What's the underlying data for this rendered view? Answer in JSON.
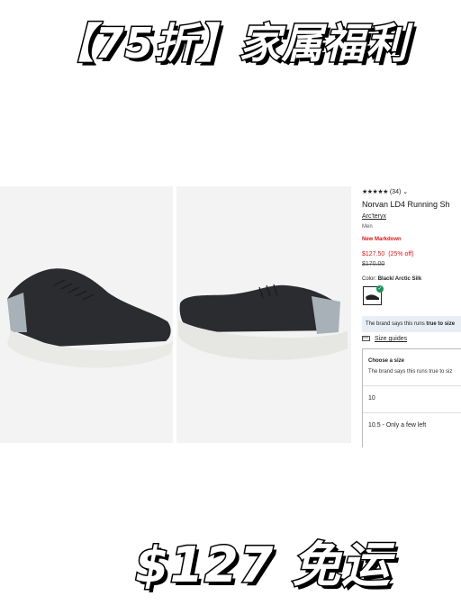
{
  "promo": {
    "top_text": "【75折】家属福利",
    "bottom_text": "$127 免运"
  },
  "product": {
    "stars": "★★★★★",
    "review_count": "(34)",
    "chevron": "⌄",
    "title": "Norvan LD4 Running Sh",
    "brand": "Arc'teryx",
    "category": "Men",
    "badge": "New Markdown",
    "sale_price": "$127.50",
    "discount": "(25% off)",
    "original_price": "$170.00",
    "color_label": "Color:",
    "color_value": "Black/ Arctic Silk",
    "fit_prefix": "The brand says this runs ",
    "fit_bold": "true to size",
    "size_guides": "Size guides",
    "choose_size": "Choose a size",
    "size_note": "The brand says this runs true to siz",
    "sizes": [
      "10",
      "10.5 - Only a few left"
    ]
  }
}
